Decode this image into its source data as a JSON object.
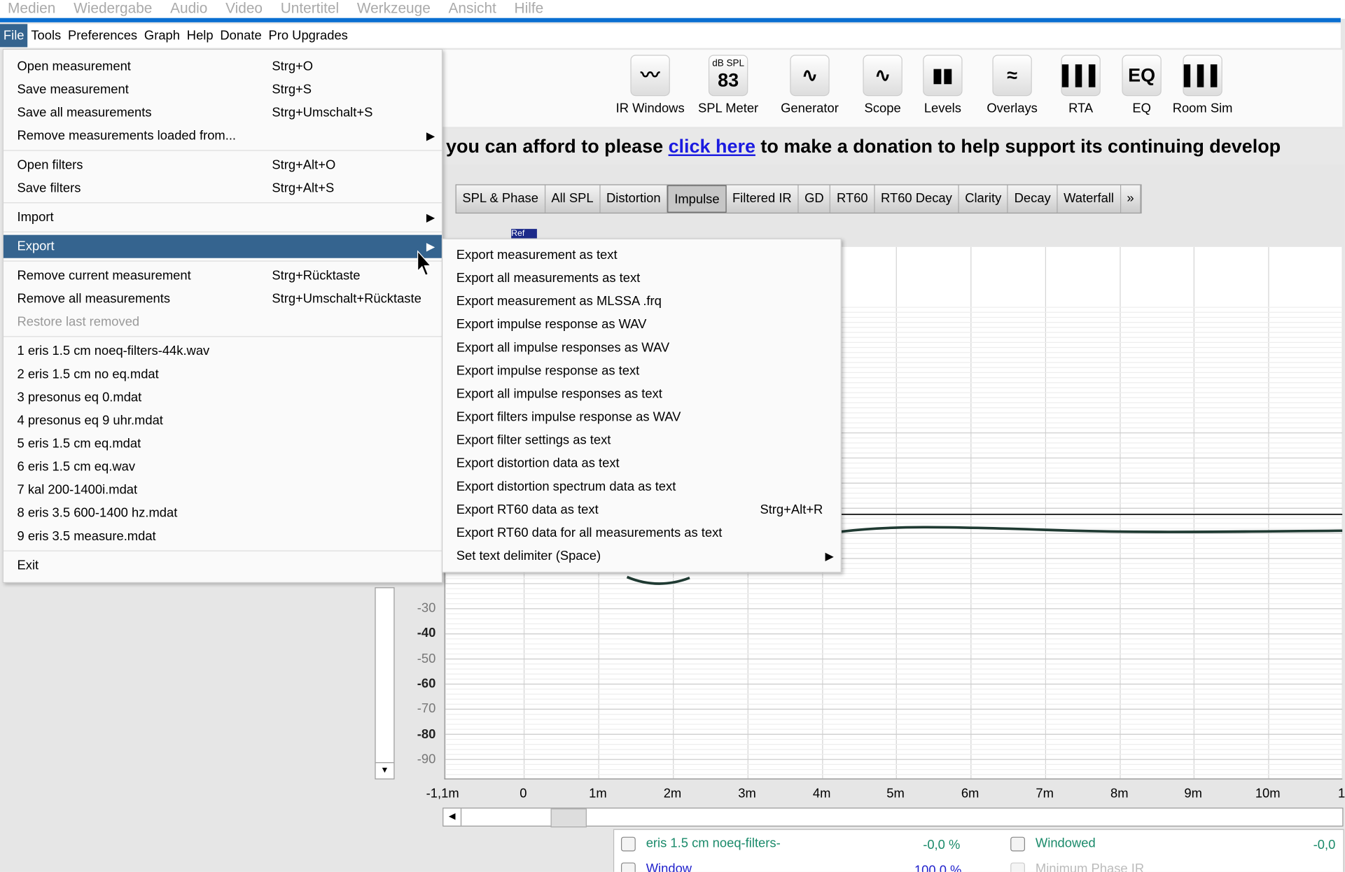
{
  "player_menu": [
    "Medien",
    "Wiedergabe",
    "Audio",
    "Video",
    "Untertitel",
    "Werkzeuge",
    "Ansicht",
    "Hilfe"
  ],
  "menubar": [
    "File",
    "Tools",
    "Preferences",
    "Graph",
    "Help",
    "Donate",
    "Pro Upgrades"
  ],
  "toolbar": [
    {
      "label": "IR Windows",
      "icon": "ir-windows-icon",
      "glyph": "〰"
    },
    {
      "label": "SPL Meter",
      "icon": "spl-meter-icon",
      "glyph": "83",
      "sub": "dB SPL"
    },
    {
      "label": "Generator",
      "icon": "generator-icon",
      "glyph": "∿"
    },
    {
      "label": "Scope",
      "icon": "scope-icon",
      "glyph": "∿"
    },
    {
      "label": "Levels",
      "icon": "levels-icon",
      "glyph": "▮▮"
    },
    {
      "label": "Overlays",
      "icon": "overlays-icon",
      "glyph": "≈"
    },
    {
      "label": "RTA",
      "icon": "rta-icon",
      "glyph": "▌▌▌"
    },
    {
      "label": "EQ",
      "icon": "eq-icon",
      "glyph": "EQ"
    },
    {
      "label": "Room Sim",
      "icon": "room-sim-icon",
      "glyph": "▌▌▌"
    }
  ],
  "banner": {
    "before": "you can afford to please ",
    "link": "click here",
    "after": " to make a donation to help support its continuing develop"
  },
  "tabs": [
    "SPL & Phase",
    "All SPL",
    "Distortion",
    "Impulse",
    "Filtered IR",
    "GD",
    "RT60",
    "RT60 Decay",
    "Clarity",
    "Decay",
    "Waterfall",
    "»"
  ],
  "selected_tab": "Impulse",
  "graph": {
    "y_ticks": [
      "-30",
      "-40",
      "-50",
      "-60",
      "-70",
      "-80",
      "-90"
    ],
    "x_ticks": [
      "-1,1m",
      "0",
      "1m",
      "2m",
      "3m",
      "4m",
      "5m",
      "6m",
      "7m",
      "8m",
      "9m",
      "10m",
      "1"
    ],
    "ref_label": "Ref"
  },
  "file_menu": [
    {
      "label": "Open measurement",
      "shortcut": "Strg+O"
    },
    {
      "label": "Save measurement",
      "shortcut": "Strg+S"
    },
    {
      "label": "Save all measurements",
      "shortcut": "Strg+Umschalt+S"
    },
    {
      "label": "Remove measurements loaded from...",
      "submenu": true
    },
    {
      "sep": true
    },
    {
      "label": "Open filters",
      "shortcut": "Strg+Alt+O"
    },
    {
      "label": "Save filters",
      "shortcut": "Strg+Alt+S"
    },
    {
      "sep": true
    },
    {
      "label": "Import",
      "submenu": true
    },
    {
      "sep": true
    },
    {
      "label": "Export",
      "submenu": true,
      "highlight": true
    },
    {
      "sep": true
    },
    {
      "label": "Remove current measurement",
      "shortcut": "Strg+Rücktaste"
    },
    {
      "label": "Remove all measurements",
      "shortcut": "Strg+Umschalt+Rücktaste"
    },
    {
      "label": "Restore last removed",
      "disabled": true
    },
    {
      "sep": true
    },
    {
      "label": "1 eris 1.5 cm noeq-filters-44k.wav"
    },
    {
      "label": "2 eris 1.5 cm no eq.mdat"
    },
    {
      "label": "3 presonus eq 0.mdat"
    },
    {
      "label": "4 presonus eq 9 uhr.mdat"
    },
    {
      "label": "5 eris 1.5 cm eq.mdat"
    },
    {
      "label": "6 eris 1.5 cm eq.wav"
    },
    {
      "label": "7 kal 200-1400i.mdat"
    },
    {
      "label": "8 eris 3.5 600-1400 hz.mdat"
    },
    {
      "label": "9 eris 3.5 measure.mdat"
    },
    {
      "sep": true
    },
    {
      "label": "Exit"
    }
  ],
  "export_menu": [
    {
      "label": "Export measurement as text"
    },
    {
      "label": "Export all measurements as text"
    },
    {
      "label": "Export measurement as MLSSA .frq"
    },
    {
      "label": "Export impulse response as WAV"
    },
    {
      "label": "Export all impulse responses as WAV"
    },
    {
      "label": "Export impulse response as text"
    },
    {
      "label": "Export all impulse responses as text"
    },
    {
      "label": "Export filters impulse response as WAV"
    },
    {
      "label": "Export filter settings as text"
    },
    {
      "label": "Export distortion data as text"
    },
    {
      "label": "Export distortion spectrum data as text"
    },
    {
      "label": "Export RT60 data as text",
      "shortcut": "Strg+Alt+R"
    },
    {
      "label": "Export RT60 data for all measurements as text"
    },
    {
      "label": "Set text delimiter (Space)",
      "submenu": true
    }
  ],
  "legend": {
    "row1": {
      "name": "eris 1.5 cm noeq-filters-",
      "value": "-0,0 %",
      "name2": "Windowed",
      "value2": "-0,0"
    },
    "row2": {
      "name": "Window",
      "value": "100,0 %",
      "name2": "Minimum Phase IR"
    }
  },
  "colors": {
    "menu_highlight": "#35648f",
    "accent_blue": "#0a6fd1",
    "legend_green": "#1a8a6a"
  }
}
